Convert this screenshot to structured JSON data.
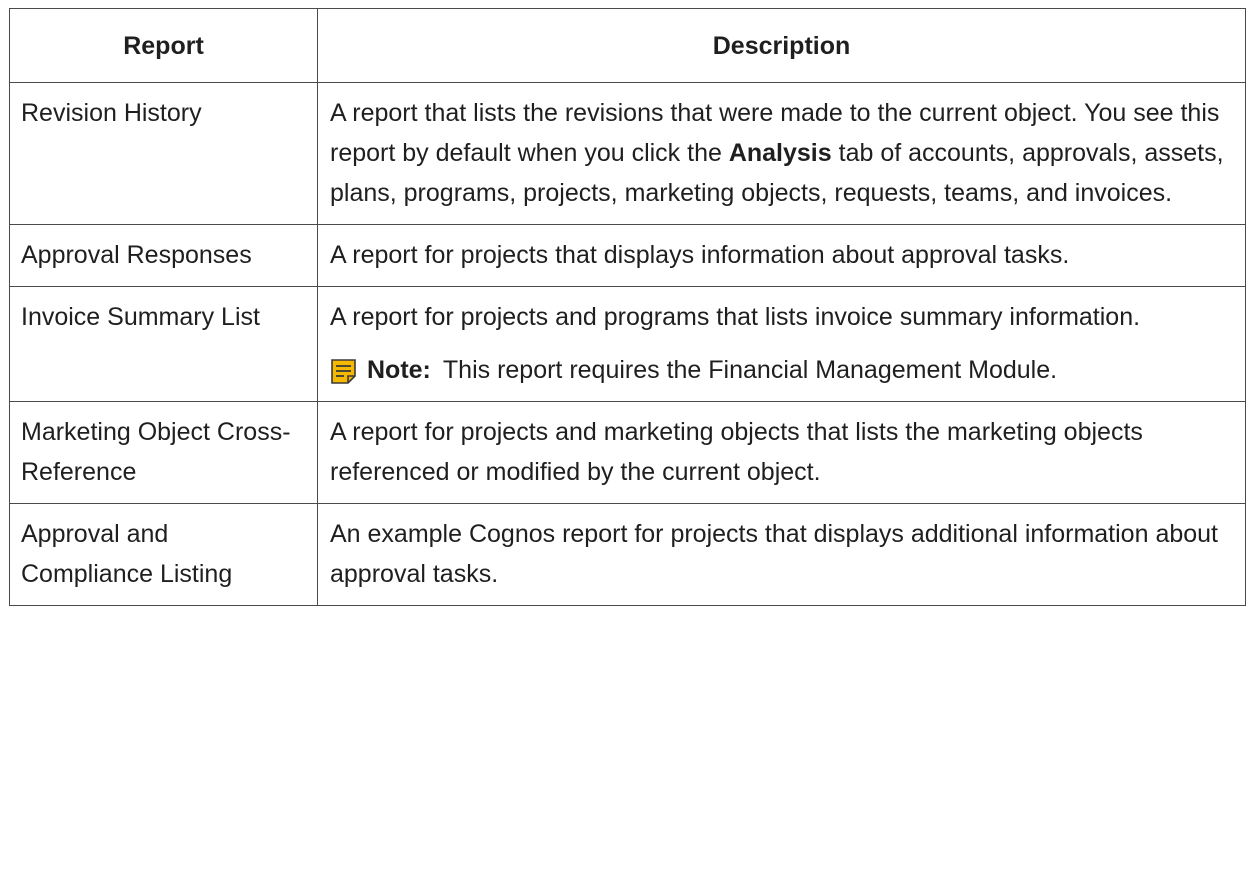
{
  "table": {
    "headers": {
      "report": "Report",
      "description": "Description"
    },
    "rows": [
      {
        "report": "Revision History",
        "desc_before": "A report that lists the revisions that were made to the current object. You see this report by default when you click the ",
        "desc_bold": "Analysis",
        "desc_after": " tab of accounts, approvals, assets, plans, programs, projects, marketing objects, requests, teams, and invoices."
      },
      {
        "report": "Approval Responses",
        "desc": "A report for projects that displays information about approval tasks."
      },
      {
        "report": "Invoice Summary List",
        "desc": "A report for projects and programs that lists invoice summary information.",
        "note_label": "Note:",
        "note_text": "This report requires the Financial Management Module."
      },
      {
        "report": "Marketing Object Cross-Reference",
        "desc": "A report for projects and marketing objects that lists the marketing objects referenced or modified by the current object."
      },
      {
        "report": "Approval and Compliance Listing",
        "desc": "An example Cognos report for projects that displays additional information about approval tasks."
      }
    ]
  },
  "icons": {
    "note": "note-icon"
  },
  "colors": {
    "note_icon": "#F5B800",
    "border": "#4a4a4a",
    "text": "#1f1f1f"
  }
}
